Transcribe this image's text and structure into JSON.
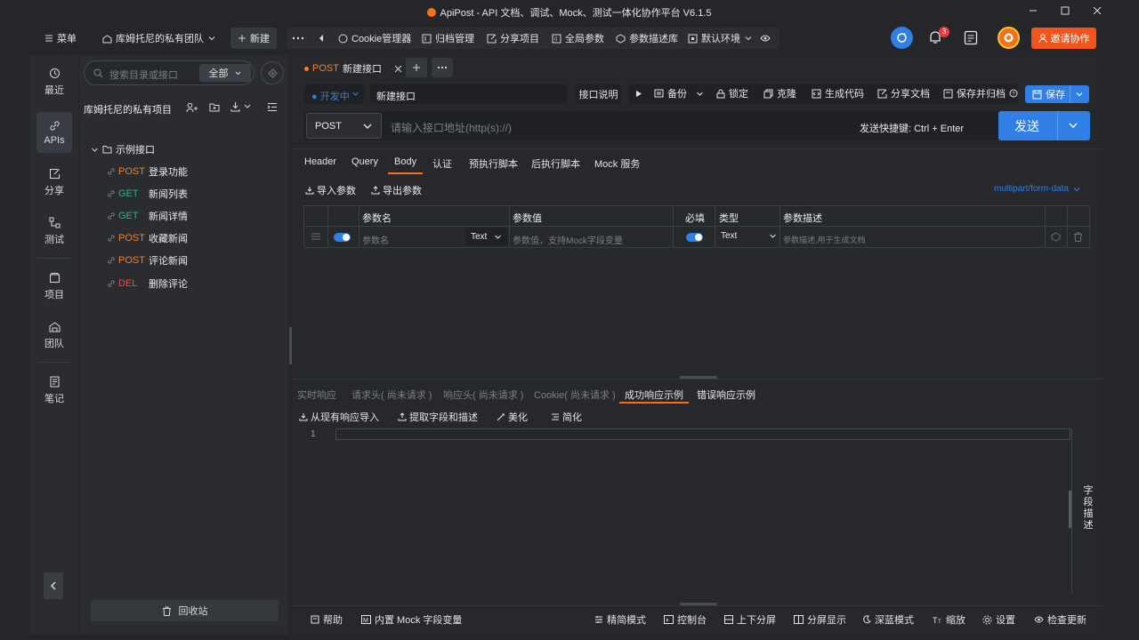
{
  "window": {
    "title": "ApiPost - API 文档、调试、Mock、测试一体化协作平台 V6.1.5"
  },
  "topbar": {
    "menu_label": "菜单",
    "team_label": "库姆托尼的私有团队",
    "new_label": "新建",
    "tools": [
      {
        "id": "cookie",
        "label": "Cookie管理器",
        "icon": "cookie-icon"
      },
      {
        "id": "archive",
        "label": "归档管理",
        "icon": "archive-icon"
      },
      {
        "id": "share",
        "label": "分享项目",
        "icon": "share-icon"
      },
      {
        "id": "global",
        "label": "全局参数",
        "icon": "global-params-icon"
      },
      {
        "id": "paramdesc",
        "label": "参数描述库",
        "icon": "cube-icon"
      },
      {
        "id": "env",
        "label": "默认环境",
        "icon": "env-icon"
      }
    ],
    "notification_count": "3",
    "invite_label": "邀请协作"
  },
  "leftnav": {
    "items": [
      {
        "id": "recent",
        "label": "最近",
        "icon": "history-icon"
      },
      {
        "id": "apis",
        "label": "APIs",
        "icon": "link-icon"
      },
      {
        "id": "share",
        "label": "分享",
        "icon": "share-icon"
      },
      {
        "id": "test",
        "label": "测试",
        "icon": "test-icon"
      },
      {
        "id": "project",
        "label": "项目",
        "icon": "project-icon"
      },
      {
        "id": "team",
        "label": "团队",
        "icon": "team-icon"
      },
      {
        "id": "notes",
        "label": "笔记",
        "icon": "notes-icon"
      }
    ],
    "active": "APIs"
  },
  "sidebar": {
    "search_placeholder": "搜索目录或接口",
    "filter_label": "全部",
    "project_name": "库姆托尼的私有项目",
    "folder_name": "示例接口",
    "items": [
      {
        "method": "POST",
        "name": "登录功能"
      },
      {
        "method": "GET",
        "name": "新闻列表"
      },
      {
        "method": "GET",
        "name": "新闻详情"
      },
      {
        "method": "POST",
        "name": "收藏新闻"
      },
      {
        "method": "POST",
        "name": "评论新闻"
      },
      {
        "method": "DEL",
        "name": "删除评论"
      }
    ],
    "recycle_label": "回收站"
  },
  "request": {
    "tab_method": "POST",
    "tab_name": "新建接口",
    "status_label": "开发中",
    "name_value": "新建接口",
    "doc_label": "接口说明",
    "actions": [
      {
        "id": "backup",
        "label": "备份",
        "icon": "backup-icon"
      },
      {
        "id": "lock",
        "label": "锁定",
        "icon": "lock-icon"
      },
      {
        "id": "clone",
        "label": "克隆",
        "icon": "clone-icon"
      },
      {
        "id": "gencode",
        "label": "生成代码",
        "icon": "code-icon"
      },
      {
        "id": "sharedoc",
        "label": "分享文档",
        "icon": "share-icon"
      },
      {
        "id": "savearchive",
        "label": "保存并归档",
        "icon": "archive-icon"
      }
    ],
    "save_label": "保存",
    "method": "POST",
    "url_placeholder": "请输入接口地址(http(s)://)",
    "shortcut_label": "发送快捷键: Ctrl + Enter",
    "send_label": "发送"
  },
  "body": {
    "tabs": [
      "Header",
      "Query",
      "Body",
      "认证",
      "预执行脚本",
      "后执行脚本",
      "Mock 服务"
    ],
    "active_tab": "Body",
    "import_label": "导入参数",
    "export_label": "导出参数",
    "content_type": "multipart/form-data",
    "columns": {
      "name": "参数名",
      "value": "参数值",
      "required": "必填",
      "type": "类型",
      "desc": "参数描述"
    },
    "row": {
      "name_placeholder": "参数名",
      "name_type": "Text",
      "value_placeholder": "参数值，支持Mock字段变量",
      "type": "Text",
      "desc_placeholder": "参数描述,用于生成文档"
    }
  },
  "response": {
    "tabs": [
      "实时响应",
      "请求头( 尚未请求 )",
      "响应头( 尚未请求 )",
      "Cookie( 尚未请求 )",
      "成功响应示例",
      "错误响应示例"
    ],
    "active_tab": "成功响应示例",
    "actions": [
      "从现有响应导入",
      "提取字段和描述",
      "美化",
      "简化"
    ],
    "line_number": "1",
    "side_label": "字段描述"
  },
  "footer": {
    "help": "帮助",
    "mock_vars": "内置 Mock 字段变量",
    "items": [
      "精简模式",
      "控制台",
      "上下分屏",
      "分屏显示",
      "深蓝模式",
      "缩放",
      "设置",
      "检查更新"
    ]
  },
  "colors": {
    "accent_orange": "#f2711c",
    "accent_blue": "#2f7fe6",
    "post": "#f0822a",
    "get": "#2fb28e",
    "del": "#ee4a4a"
  }
}
